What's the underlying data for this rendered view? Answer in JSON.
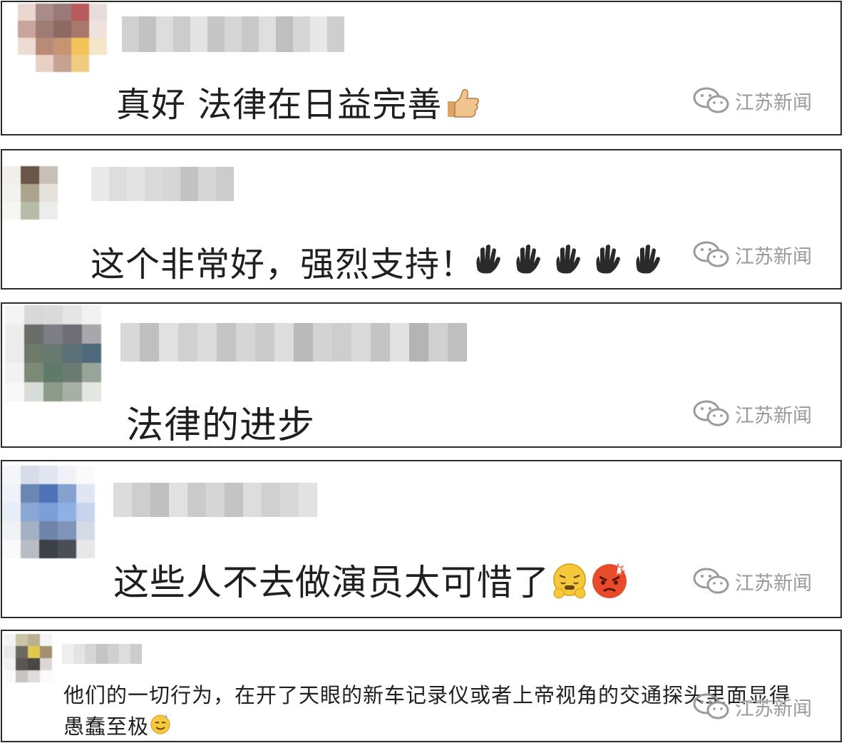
{
  "comments": [
    {
      "text": "真好 法律在日益完善",
      "watermark": "江苏新闻",
      "emoji": "thumbs-up"
    },
    {
      "text": "这个非常好，强烈支持！",
      "watermark": "江苏新闻",
      "emoji": "raised-hands"
    },
    {
      "text": "法律的进步",
      "watermark": "江苏新闻"
    },
    {
      "text": "这些人不去做演员太可惜了",
      "watermark": "江苏新闻",
      "emoji": "grimace-and-angry"
    },
    {
      "text_line1": "他们的一切行为，在开了天眼的新车记录仪或者上帝视角的交通探头里面显得",
      "text_line2": "愚蠢至极",
      "watermark": "江苏新闻",
      "emoji": "sweat-smile"
    }
  ],
  "colors": {
    "border": "#2b2b2b",
    "text": "#1f1f1f",
    "watermark": "#9a9a9a"
  }
}
